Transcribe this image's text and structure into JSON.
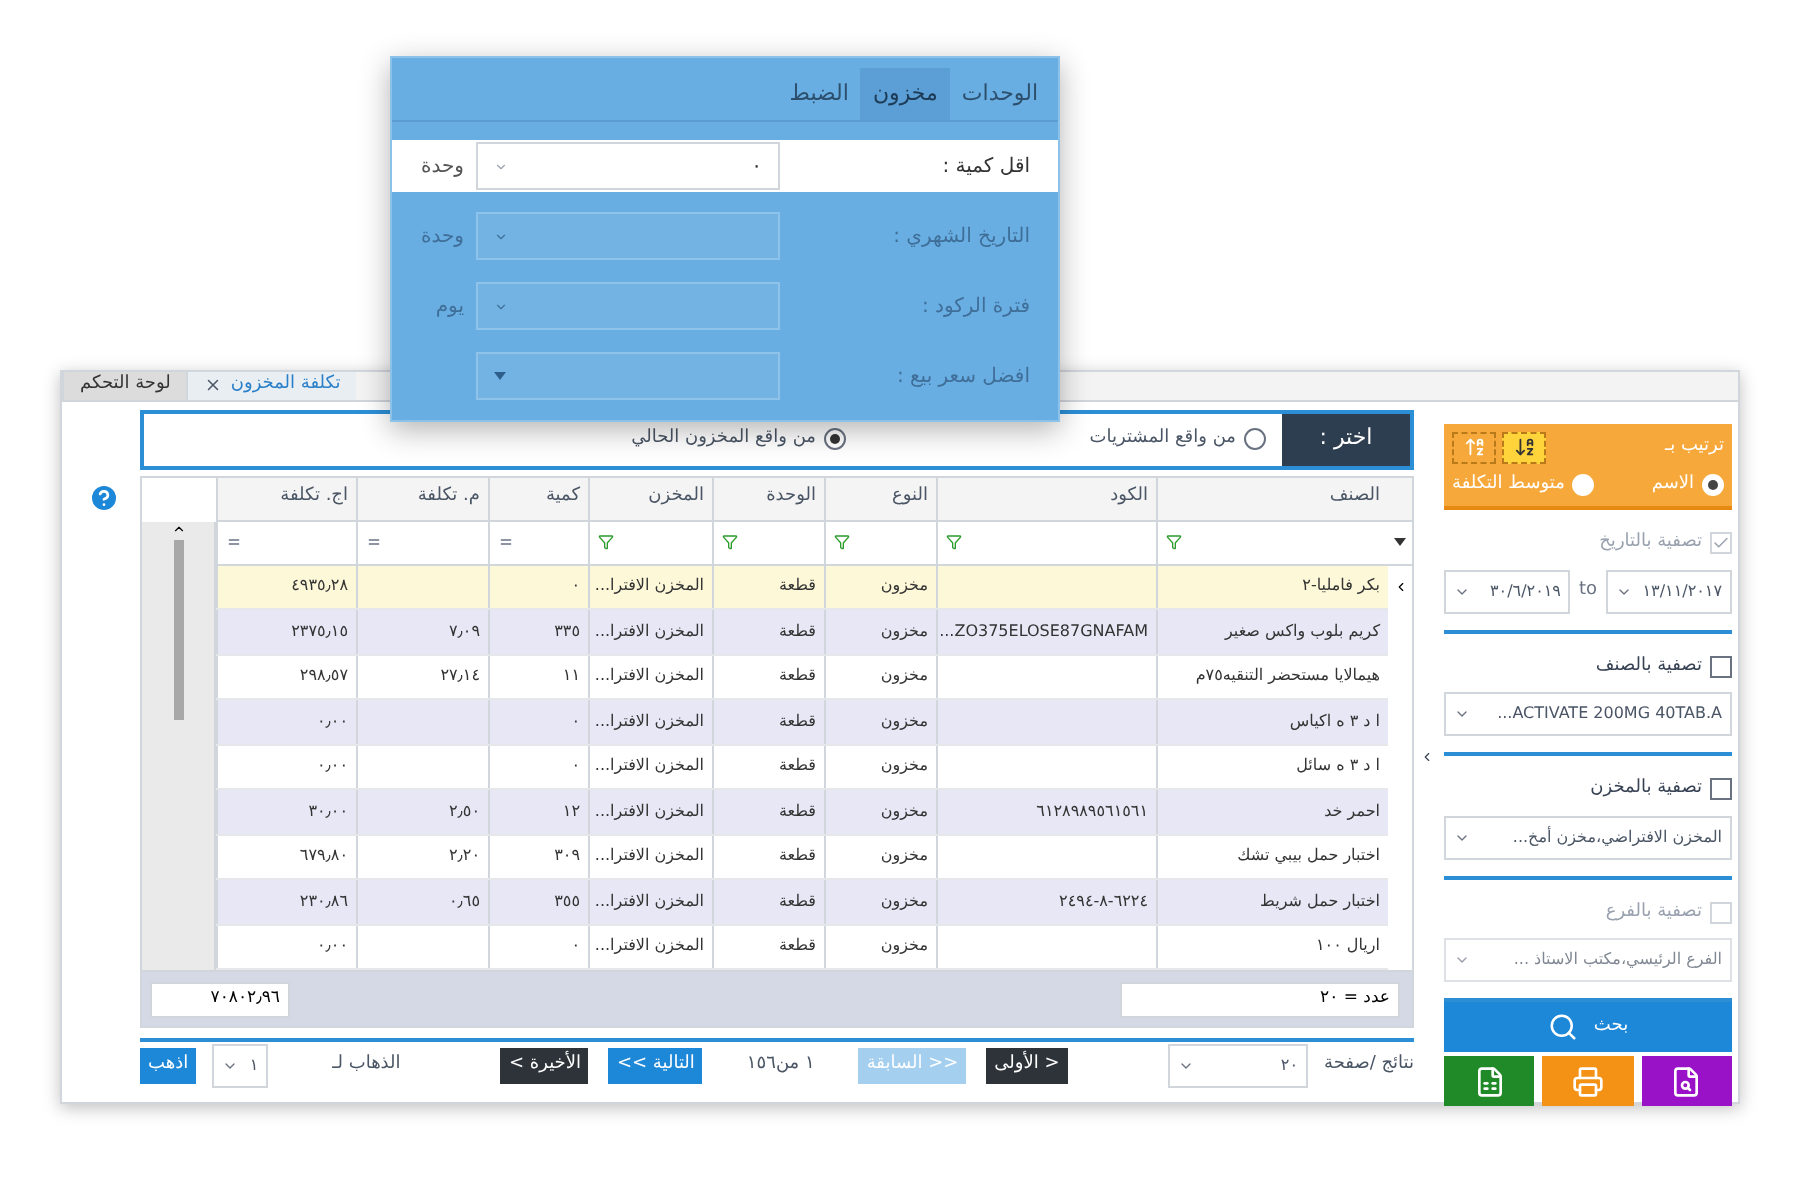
{
  "popup": {
    "tabs": [
      {
        "label": "الوحدات",
        "selected": false
      },
      {
        "label": "مخزون",
        "selected": true
      },
      {
        "label": "الضبط",
        "selected": false
      }
    ],
    "fields": [
      {
        "label": "اقل كمية :",
        "kind": "number",
        "value": "٠",
        "unit": "وحدة",
        "disabled": false
      },
      {
        "label": "التاريخ الشهري :",
        "kind": "number",
        "unit": "وحدة",
        "disabled": true
      },
      {
        "label": "فترة الركود :",
        "kind": "number",
        "unit": "يوم",
        "disabled": true
      },
      {
        "label": "افضل سعر بيع :",
        "kind": "select",
        "disabled": true
      }
    ]
  },
  "tabs": [
    {
      "label": "تكلفة المخزون",
      "selected": true,
      "closable": true
    },
    {
      "label": "لوحة التحكم",
      "selected": false,
      "closable": false
    }
  ],
  "source": {
    "label": "اختر :",
    "options": [
      {
        "label": "من واقع المشتريات",
        "selected": false
      },
      {
        "label": "من واقع المخزون الحالي",
        "selected": true
      }
    ]
  },
  "table": {
    "columns": [
      {
        "label": "الصنف",
        "kind": "text"
      },
      {
        "label": "الكود",
        "kind": "text"
      },
      {
        "label": "النوع",
        "kind": "text"
      },
      {
        "label": "الوحدة",
        "kind": "text"
      },
      {
        "label": "المخزن",
        "kind": "text"
      },
      {
        "label": "كمية",
        "kind": "number"
      },
      {
        "label": "م. تكلفة",
        "kind": "number"
      },
      {
        "label": "اج. تكلفة",
        "kind": "number"
      }
    ],
    "rows": [
      {
        "selected": true,
        "cells": [
          "بكر فامليا-٢",
          "",
          "مخزون",
          "قطعة",
          "المخزن الافترا...",
          "٠",
          "",
          "٤٩٣٥٫٢٨"
        ]
      },
      {
        "selected": false,
        "cells": [
          "كريم بلوب واكس صغير",
          "ZO375ELOSE87GNAFAM...",
          "مخزون",
          "قطعة",
          "المخزن الافترا...",
          "٣٣٥",
          "٧٫٠٩",
          "٢٣٧٥٫١٥"
        ]
      },
      {
        "selected": false,
        "cells": [
          "هيمالايا مستحضر التنقيه٧٥م",
          "",
          "مخزون",
          "قطعة",
          "المخزن الافترا...",
          "١١",
          "٢٧٫١٤",
          "٢٩٨٫٥٧"
        ]
      },
      {
        "selected": false,
        "cells": [
          "ا د ٣ ه اكياس",
          "",
          "مخزون",
          "قطعة",
          "المخزن الافترا...",
          "٠",
          "",
          "٠٫٠٠"
        ]
      },
      {
        "selected": false,
        "cells": [
          "ا د ٣ ه سائل",
          "",
          "مخزون",
          "قطعة",
          "المخزن الافترا...",
          "٠",
          "",
          "٠٫٠٠"
        ]
      },
      {
        "selected": false,
        "cells": [
          "احمر خد",
          "٦١٢٨٩٨٩٥٦١٥٦١",
          "مخزون",
          "قطعة",
          "المخزن الافترا...",
          "١٢",
          "٢٫٥٠",
          "٣٠٫٠٠"
        ]
      },
      {
        "selected": false,
        "cells": [
          "اختبار حمل بيبي تشك",
          "",
          "مخزون",
          "قطعة",
          "المخزن الافترا...",
          "٣٠٩",
          "٢٫٢٠",
          "٦٧٩٫٨٠"
        ]
      },
      {
        "selected": false,
        "cells": [
          "اختبار حمل شريط",
          "٦٢٢٤-٨-٢٤٩٤",
          "مخزون",
          "قطعة",
          "المخزن الافترا...",
          "٣٥٥",
          "٠٫٦٥",
          "٢٣٠٫٨٦"
        ]
      },
      {
        "selected": false,
        "cells": [
          "اريال ١٠٠",
          "",
          "مخزون",
          "قطعة",
          "المخزن الافترا...",
          "٠",
          "",
          "٠٫٠٠"
        ]
      }
    ],
    "footer": {
      "count": "عدد = ٢٠",
      "total": "٧٠٨٠٢٫٩٦"
    }
  },
  "pagination": {
    "page_size_label": "نتائج /صفحة",
    "page_size": "٢٠",
    "nav": [
      {
        "kind": "dark",
        "label": "< الأولى",
        "disabled": false
      },
      {
        "kind": "blue",
        "label": "<< السابقة",
        "disabled": true
      },
      {
        "kind": "text",
        "label": "١ من١٥٦"
      },
      {
        "kind": "blue",
        "label": "التالية >>",
        "disabled": false
      },
      {
        "kind": "dark",
        "label": "الأخيرة >",
        "disabled": false
      }
    ],
    "goto_label": "الذهاب لـ",
    "goto_value": "١",
    "go_button": "اذهب"
  },
  "sidebar": {
    "sort": {
      "title": "ترتيب بـ",
      "buttons": [
        {
          "kind": "descending",
          "selected": true
        },
        {
          "kind": "ascending",
          "selected": false
        }
      ],
      "options": [
        {
          "label": "الاسم",
          "selected": true
        },
        {
          "label": "متوسط التكلفة",
          "selected": false
        }
      ]
    },
    "date_filter": {
      "label": "تصفية بالتاريخ",
      "checked": true,
      "disabled": true,
      "from": "١٣/١١/٢٠١٧",
      "to_label": "to",
      "to": "٣٠/٦/٢٠١٩"
    },
    "filters": [
      {
        "label": "تصفية بالصنف",
        "checked": false,
        "disabled": false,
        "value": "ACTIVATE 200MG 40TAB.A..."
      },
      {
        "label": "تصفية بالمخزن",
        "checked": false,
        "disabled": false,
        "value": "المخزن الافتراضي،مخزن أمخ..."
      },
      {
        "label": "تصفية بالفرع",
        "checked": false,
        "disabled": true,
        "value": "الفرع الرئيسي،مكتب الاستاذ ..."
      }
    ],
    "search_button": "بحث",
    "actions": [
      {
        "kind": "preview"
      },
      {
        "kind": "print"
      },
      {
        "kind": "excel"
      }
    ]
  }
}
